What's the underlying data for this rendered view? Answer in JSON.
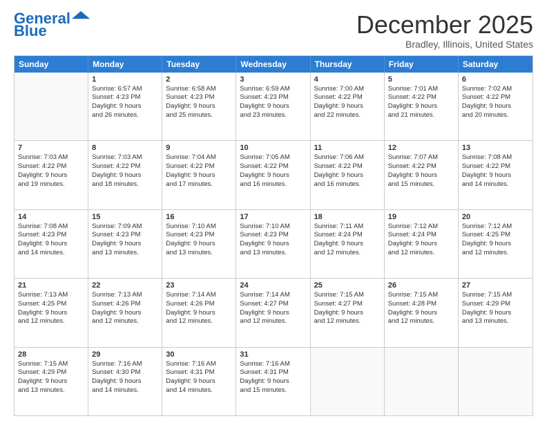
{
  "logo": {
    "text1": "General",
    "text2": "Blue",
    "arrow_color": "#1a6bbd"
  },
  "title": "December 2025",
  "location": "Bradley, Illinois, United States",
  "days_of_week": [
    "Sunday",
    "Monday",
    "Tuesday",
    "Wednesday",
    "Thursday",
    "Friday",
    "Saturday"
  ],
  "weeks": [
    [
      {
        "day": "",
        "empty": true
      },
      {
        "day": "1",
        "sunrise": "Sunrise: 6:57 AM",
        "sunset": "Sunset: 4:23 PM",
        "daylight": "Daylight: 9 hours and 26 minutes."
      },
      {
        "day": "2",
        "sunrise": "Sunrise: 6:58 AM",
        "sunset": "Sunset: 4:23 PM",
        "daylight": "Daylight: 9 hours and 25 minutes."
      },
      {
        "day": "3",
        "sunrise": "Sunrise: 6:59 AM",
        "sunset": "Sunset: 4:23 PM",
        "daylight": "Daylight: 9 hours and 23 minutes."
      },
      {
        "day": "4",
        "sunrise": "Sunrise: 7:00 AM",
        "sunset": "Sunset: 4:22 PM",
        "daylight": "Daylight: 9 hours and 22 minutes."
      },
      {
        "day": "5",
        "sunrise": "Sunrise: 7:01 AM",
        "sunset": "Sunset: 4:22 PM",
        "daylight": "Daylight: 9 hours and 21 minutes."
      },
      {
        "day": "6",
        "sunrise": "Sunrise: 7:02 AM",
        "sunset": "Sunset: 4:22 PM",
        "daylight": "Daylight: 9 hours and 20 minutes."
      }
    ],
    [
      {
        "day": "7",
        "sunrise": "Sunrise: 7:03 AM",
        "sunset": "Sunset: 4:22 PM",
        "daylight": "Daylight: 9 hours and 19 minutes."
      },
      {
        "day": "8",
        "sunrise": "Sunrise: 7:03 AM",
        "sunset": "Sunset: 4:22 PM",
        "daylight": "Daylight: 9 hours and 18 minutes."
      },
      {
        "day": "9",
        "sunrise": "Sunrise: 7:04 AM",
        "sunset": "Sunset: 4:22 PM",
        "daylight": "Daylight: 9 hours and 17 minutes."
      },
      {
        "day": "10",
        "sunrise": "Sunrise: 7:05 AM",
        "sunset": "Sunset: 4:22 PM",
        "daylight": "Daylight: 9 hours and 16 minutes."
      },
      {
        "day": "11",
        "sunrise": "Sunrise: 7:06 AM",
        "sunset": "Sunset: 4:22 PM",
        "daylight": "Daylight: 9 hours and 16 minutes."
      },
      {
        "day": "12",
        "sunrise": "Sunrise: 7:07 AM",
        "sunset": "Sunset: 4:22 PM",
        "daylight": "Daylight: 9 hours and 15 minutes."
      },
      {
        "day": "13",
        "sunrise": "Sunrise: 7:08 AM",
        "sunset": "Sunset: 4:22 PM",
        "daylight": "Daylight: 9 hours and 14 minutes."
      }
    ],
    [
      {
        "day": "14",
        "sunrise": "Sunrise: 7:08 AM",
        "sunset": "Sunset: 4:23 PM",
        "daylight": "Daylight: 9 hours and 14 minutes."
      },
      {
        "day": "15",
        "sunrise": "Sunrise: 7:09 AM",
        "sunset": "Sunset: 4:23 PM",
        "daylight": "Daylight: 9 hours and 13 minutes."
      },
      {
        "day": "16",
        "sunrise": "Sunrise: 7:10 AM",
        "sunset": "Sunset: 4:23 PM",
        "daylight": "Daylight: 9 hours and 13 minutes."
      },
      {
        "day": "17",
        "sunrise": "Sunrise: 7:10 AM",
        "sunset": "Sunset: 4:23 PM",
        "daylight": "Daylight: 9 hours and 13 minutes."
      },
      {
        "day": "18",
        "sunrise": "Sunrise: 7:11 AM",
        "sunset": "Sunset: 4:24 PM",
        "daylight": "Daylight: 9 hours and 12 minutes."
      },
      {
        "day": "19",
        "sunrise": "Sunrise: 7:12 AM",
        "sunset": "Sunset: 4:24 PM",
        "daylight": "Daylight: 9 hours and 12 minutes."
      },
      {
        "day": "20",
        "sunrise": "Sunrise: 7:12 AM",
        "sunset": "Sunset: 4:25 PM",
        "daylight": "Daylight: 9 hours and 12 minutes."
      }
    ],
    [
      {
        "day": "21",
        "sunrise": "Sunrise: 7:13 AM",
        "sunset": "Sunset: 4:25 PM",
        "daylight": "Daylight: 9 hours and 12 minutes."
      },
      {
        "day": "22",
        "sunrise": "Sunrise: 7:13 AM",
        "sunset": "Sunset: 4:26 PM",
        "daylight": "Daylight: 9 hours and 12 minutes."
      },
      {
        "day": "23",
        "sunrise": "Sunrise: 7:14 AM",
        "sunset": "Sunset: 4:26 PM",
        "daylight": "Daylight: 9 hours and 12 minutes."
      },
      {
        "day": "24",
        "sunrise": "Sunrise: 7:14 AM",
        "sunset": "Sunset: 4:27 PM",
        "daylight": "Daylight: 9 hours and 12 minutes."
      },
      {
        "day": "25",
        "sunrise": "Sunrise: 7:15 AM",
        "sunset": "Sunset: 4:27 PM",
        "daylight": "Daylight: 9 hours and 12 minutes."
      },
      {
        "day": "26",
        "sunrise": "Sunrise: 7:15 AM",
        "sunset": "Sunset: 4:28 PM",
        "daylight": "Daylight: 9 hours and 12 minutes."
      },
      {
        "day": "27",
        "sunrise": "Sunrise: 7:15 AM",
        "sunset": "Sunset: 4:29 PM",
        "daylight": "Daylight: 9 hours and 13 minutes."
      }
    ],
    [
      {
        "day": "28",
        "sunrise": "Sunrise: 7:15 AM",
        "sunset": "Sunset: 4:29 PM",
        "daylight": "Daylight: 9 hours and 13 minutes."
      },
      {
        "day": "29",
        "sunrise": "Sunrise: 7:16 AM",
        "sunset": "Sunset: 4:30 PM",
        "daylight": "Daylight: 9 hours and 14 minutes."
      },
      {
        "day": "30",
        "sunrise": "Sunrise: 7:16 AM",
        "sunset": "Sunset: 4:31 PM",
        "daylight": "Daylight: 9 hours and 14 minutes."
      },
      {
        "day": "31",
        "sunrise": "Sunrise: 7:16 AM",
        "sunset": "Sunset: 4:31 PM",
        "daylight": "Daylight: 9 hours and 15 minutes."
      },
      {
        "day": "",
        "empty": true
      },
      {
        "day": "",
        "empty": true
      },
      {
        "day": "",
        "empty": true
      }
    ]
  ]
}
